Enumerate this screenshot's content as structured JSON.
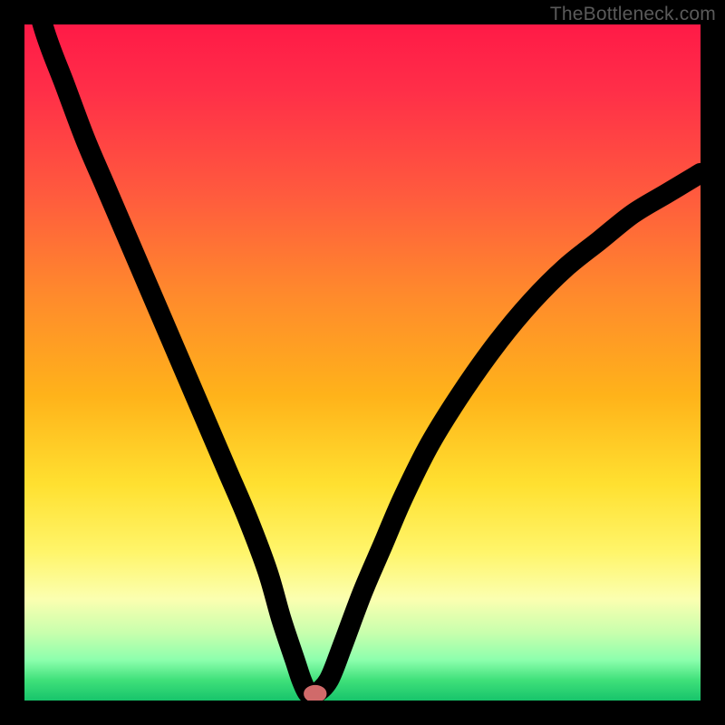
{
  "watermark": "TheBottleneck.com",
  "chart_data": {
    "type": "line",
    "title": "",
    "xlabel": "",
    "ylabel": "",
    "xlim": [
      0,
      100
    ],
    "ylim": [
      0,
      100
    ],
    "grid": false,
    "legend": false,
    "series": [
      {
        "name": "curve",
        "x": [
          0,
          3,
          6,
          9,
          12,
          15,
          18,
          21,
          24,
          27,
          30,
          33,
          36,
          38,
          40,
          41,
          42,
          43,
          45,
          47,
          50,
          53,
          56,
          60,
          65,
          70,
          75,
          80,
          85,
          90,
          95,
          100
        ],
        "y": [
          110,
          99,
          91,
          83,
          76,
          69,
          62,
          55,
          48,
          41,
          34,
          27,
          19,
          12,
          6,
          3,
          1,
          1,
          3,
          8,
          16,
          23,
          30,
          38,
          46,
          53,
          59,
          64,
          68,
          72,
          75,
          78
        ]
      }
    ],
    "marker": {
      "x": 43,
      "y": 1
    },
    "background_gradient": {
      "top": "#ff1a47",
      "mid": "#ffe030",
      "bottom": "#17c46b"
    }
  }
}
